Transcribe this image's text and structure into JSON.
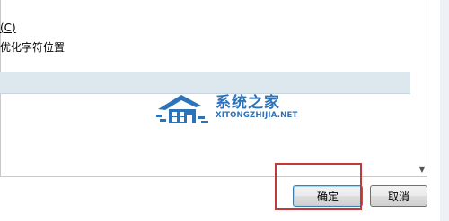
{
  "options": [
    {
      "label_tail": "(C)"
    },
    {
      "label_tail": "优化字符位置"
    }
  ],
  "buttons": {
    "ok_label": "确定",
    "cancel_label": "取消"
  },
  "watermark": {
    "title": "系统之家",
    "subtitle": "XITONGZHIJIA.NET"
  },
  "colors": {
    "highlight": "#dde7ee",
    "annotation_frame": "#c0393b",
    "watermark": "#2d73b9"
  }
}
